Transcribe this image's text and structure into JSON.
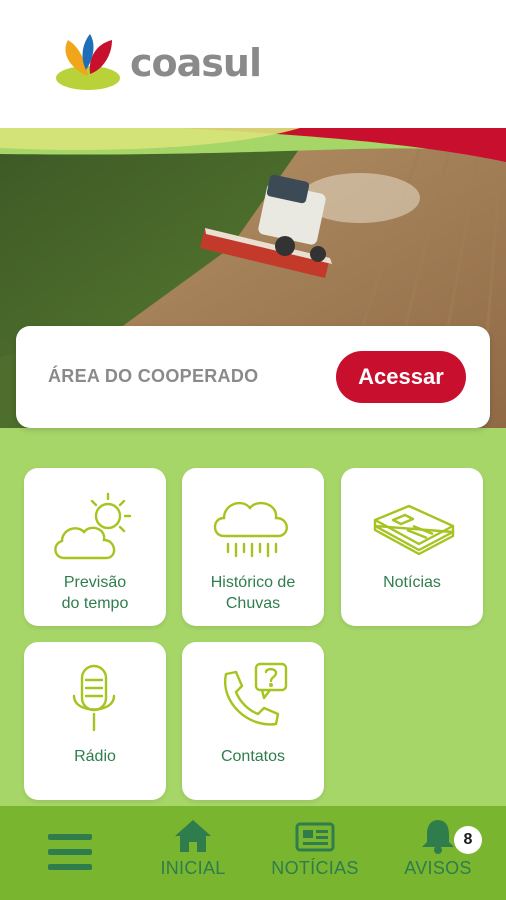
{
  "brand": {
    "name": "coasul"
  },
  "access_card": {
    "label": "ÁREA DO COOPERADO",
    "button": "Acessar"
  },
  "tiles": [
    {
      "label": "Previsão\ndo tempo",
      "icon": "weather-icon"
    },
    {
      "label": "Histórico de\nChuvas",
      "icon": "rain-cloud-icon"
    },
    {
      "label": "Notícias",
      "icon": "newspaper-icon"
    },
    {
      "label": "Rádio",
      "icon": "microphone-icon"
    },
    {
      "label": "Contatos",
      "icon": "phone-question-icon"
    }
  ],
  "nav": {
    "menu_icon": "hamburger-icon",
    "items": [
      {
        "label": "INICIAL",
        "icon": "home-icon"
      },
      {
        "label": "NOTÍCIAS",
        "icon": "news-icon"
      },
      {
        "label": "AVISOS",
        "icon": "bell-icon"
      }
    ],
    "avisos_count": "8"
  },
  "colors": {
    "brand_red": "#c8102e",
    "brand_green": "#79b52f",
    "light_green": "#a6d568",
    "text_green": "#2f7d4d",
    "icon_green": "#a5c41f"
  }
}
